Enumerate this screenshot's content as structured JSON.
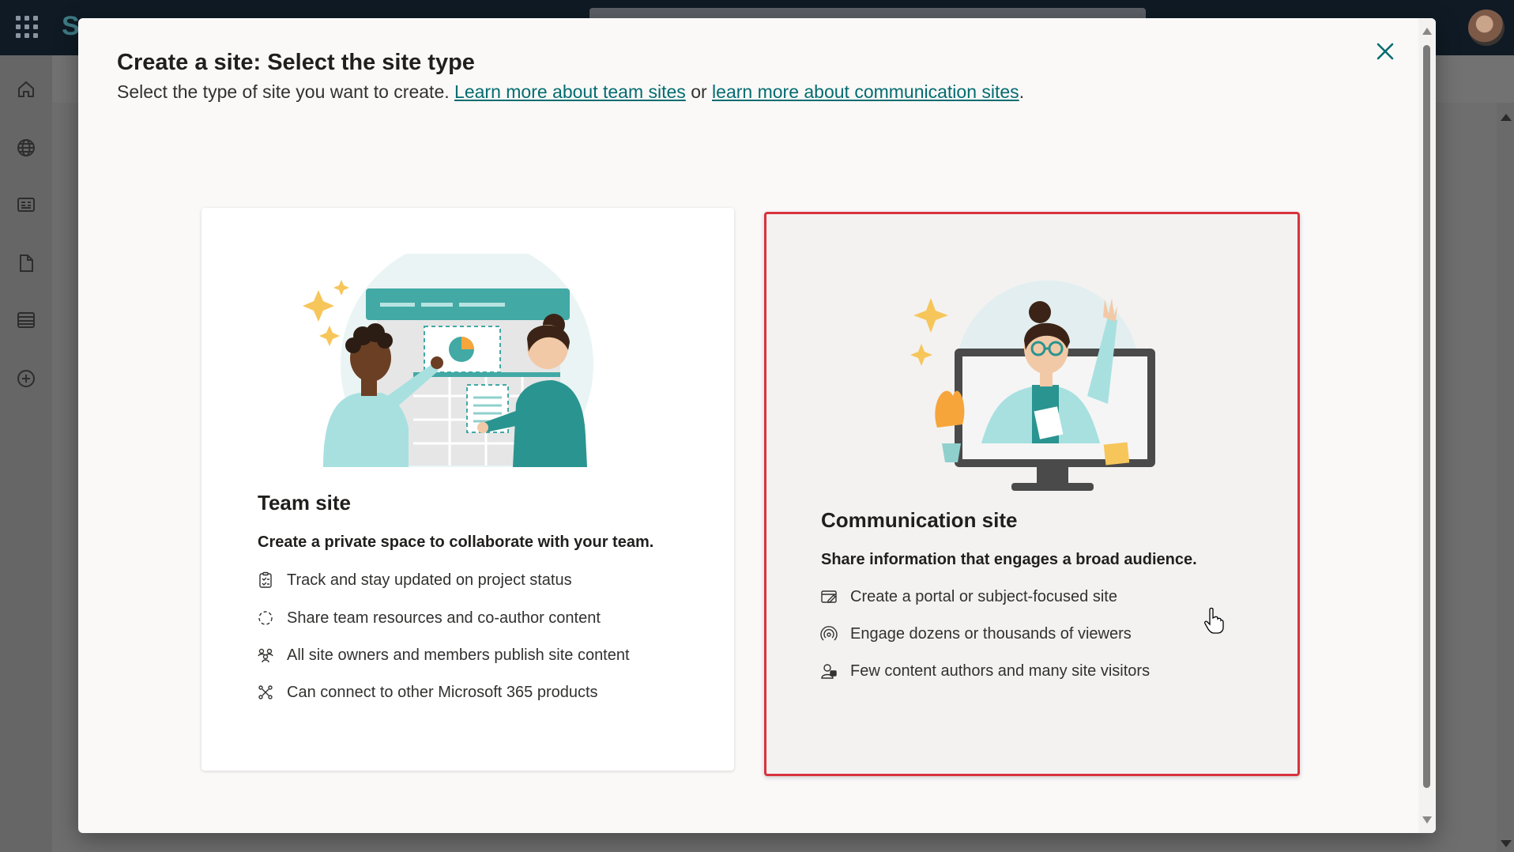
{
  "background": {
    "brand_glyph": "S",
    "rail_icons": [
      "home-icon",
      "globe-icon",
      "news-icon",
      "document-icon",
      "list-icon",
      "add-circle-icon"
    ]
  },
  "dialog": {
    "title": "Create a site: Select the site type",
    "subtitle_prefix": "Select the type of site you want to create. ",
    "link_team": "Learn more about team sites",
    "subtitle_or": " or ",
    "link_comm": "learn more about communication sites",
    "subtitle_suffix": ".",
    "close_icon": "close-icon"
  },
  "cards": {
    "team": {
      "title": "Team site",
      "description": "Create a private space to collaborate with your team.",
      "features": [
        {
          "icon": "clipboard-icon",
          "text": "Track and stay updated on project status"
        },
        {
          "icon": "sync-circle-icon",
          "text": "Share team resources and co-author content"
        },
        {
          "icon": "people-icon",
          "text": "All site owners and members publish site content"
        },
        {
          "icon": "connector-icon",
          "text": "Can connect to other Microsoft 365 products"
        }
      ]
    },
    "communication": {
      "title": "Communication site",
      "description": "Share information that engages a broad audience.",
      "features": [
        {
          "icon": "portal-edit-icon",
          "text": "Create a portal or subject-focused site"
        },
        {
          "icon": "broadcast-icon",
          "text": "Engage dozens or thousands of viewers"
        },
        {
          "icon": "person-feedback-icon",
          "text": "Few content authors and many site visitors"
        }
      ]
    }
  },
  "colors": {
    "accent": "#036c70",
    "teal": "#42a9a5",
    "highlight_border": "#d9323e"
  }
}
